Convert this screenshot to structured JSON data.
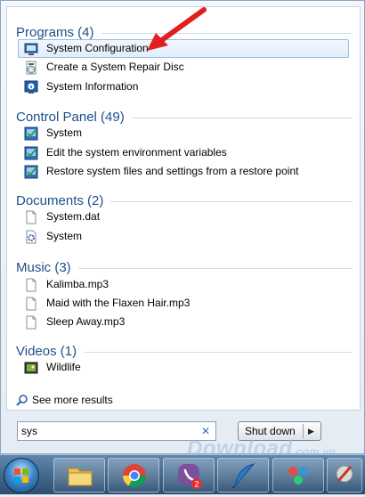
{
  "results": {
    "groups": [
      {
        "header": "Programs (4)",
        "items": [
          {
            "label": "System Configuration",
            "icon": "system-configuration-icon",
            "selected": true
          },
          {
            "label": "Create a System Repair Disc",
            "icon": "repair-disc-icon"
          },
          {
            "label": "System Information",
            "icon": "system-information-icon"
          }
        ]
      },
      {
        "header": "Control Panel (49)",
        "items": [
          {
            "label": "System",
            "icon": "control-panel-icon"
          },
          {
            "label": "Edit the system environment variables",
            "icon": "control-panel-icon"
          },
          {
            "label": "Restore system files and settings from a restore point",
            "icon": "control-panel-icon"
          }
        ]
      },
      {
        "header": "Documents (2)",
        "items": [
          {
            "label": "System.dat",
            "icon": "file-icon"
          },
          {
            "label": "System",
            "icon": "gear-file-icon"
          }
        ]
      },
      {
        "header": "Music (3)",
        "items": [
          {
            "label": "Kalimba.mp3",
            "icon": "file-icon"
          },
          {
            "label": "Maid with the Flaxen Hair.mp3",
            "icon": "file-icon"
          },
          {
            "label": "Sleep Away.mp3",
            "icon": "file-icon"
          }
        ]
      },
      {
        "header": "Videos (1)",
        "items": [
          {
            "label": "Wildlife",
            "icon": "video-icon"
          }
        ]
      }
    ],
    "see_more": "See more results"
  },
  "search": {
    "value": "sys"
  },
  "shutdown": {
    "label": "Shut down"
  },
  "watermark": {
    "text": "Download",
    "suffix": ".com.vn"
  },
  "taskbar": {
    "viber_badge": "2"
  },
  "colors": {
    "header": "#1f4e8c",
    "selected_bg": "#e2edfb",
    "annotation_arrow": "#e02020"
  }
}
